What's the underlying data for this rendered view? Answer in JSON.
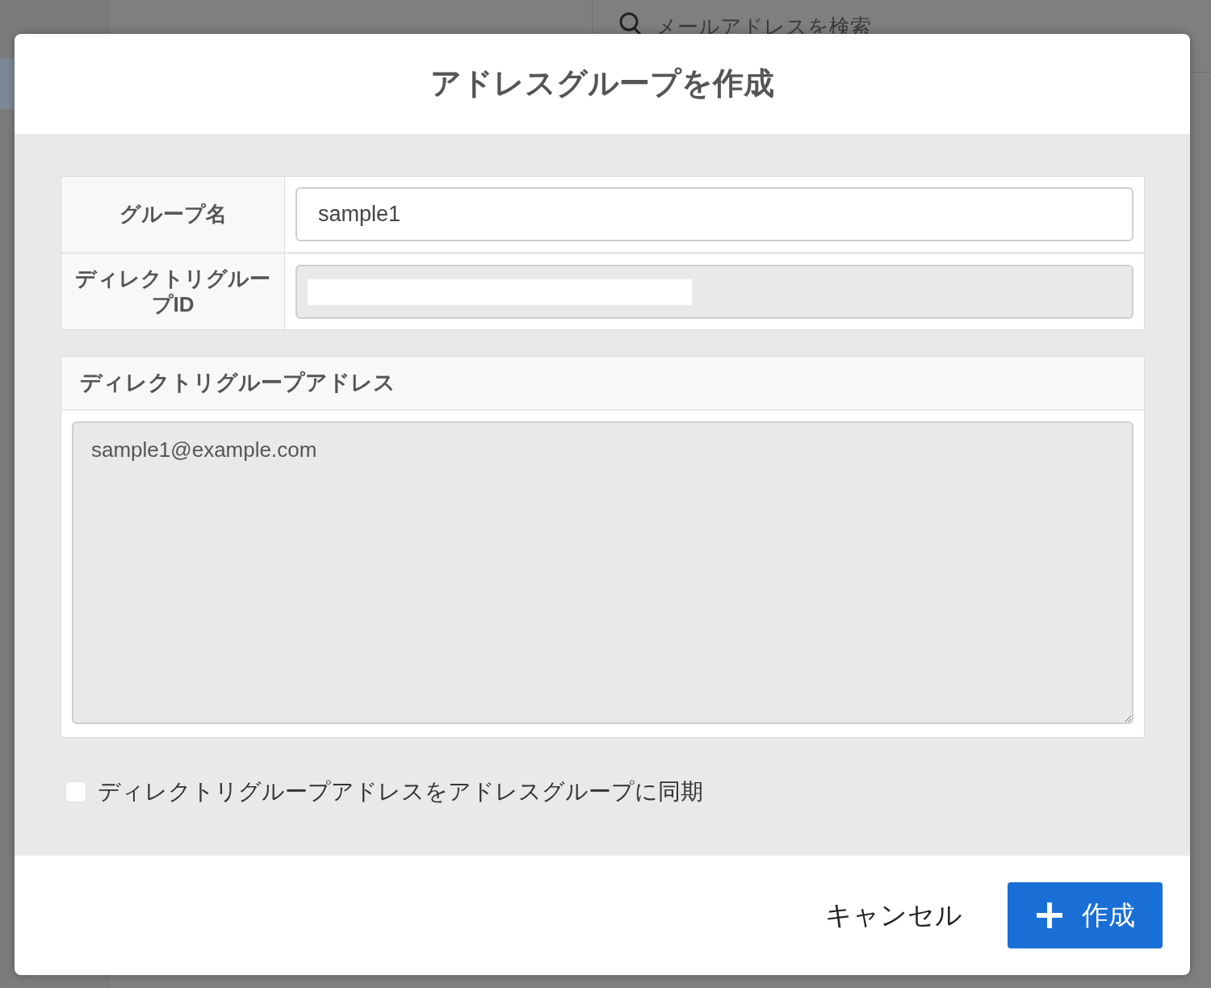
{
  "background": {
    "search": {
      "placeholder": "メールアドレスを検索"
    }
  },
  "dialog": {
    "title": "アドレスグループを作成",
    "fields": [
      {
        "label": "グループ名",
        "kind": "text",
        "value": "sample1",
        "disabled": false
      },
      {
        "label": "ディレクトリグループID",
        "kind": "redacted",
        "disabled": true
      }
    ],
    "address_section": {
      "heading": "ディレクトリグループアドレス",
      "value": "sample1@example.com",
      "disabled": true
    },
    "sync_checkbox": {
      "label": "ディレクトリグループアドレスをアドレスグループに同期",
      "checked": false
    },
    "buttons": [
      {
        "label": "キャンセル",
        "kind": "text"
      },
      {
        "label": "作成",
        "kind": "primary"
      }
    ]
  }
}
